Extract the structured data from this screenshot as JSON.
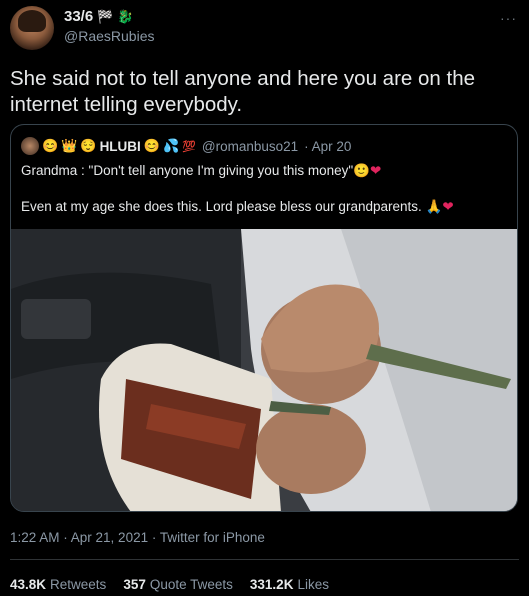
{
  "author": {
    "display_name": "33/6",
    "handle": "@RaesRubies",
    "name_icons": [
      "checkered-flag-icon",
      "dragon-icon"
    ]
  },
  "tweet": {
    "text": "She said not to tell anyone and here you are on the internet telling everybody."
  },
  "quoted": {
    "name_prefix_icons": [
      "smiling-emoji-icon",
      "crown-emoji-icon",
      "relieved-emoji-icon"
    ],
    "name": "HLUBI",
    "name_suffix_icons": [
      "blush-emoji-icon",
      "sweat-droplets-icon",
      "hundred-icon"
    ],
    "handle": "@romanbuso21",
    "date": "· Apr 20",
    "line1": "Grandma : \"Don't tell anyone I'm giving you this money\"",
    "line1_icons": [
      "slight-smile-emoji-icon",
      "red-heart-icon"
    ],
    "line2": "Even at my age she does this. Lord please bless our grandparents.",
    "line2_icons": [
      "praying-hands-icon",
      "red-heart-icon"
    ]
  },
  "meta": {
    "time": "1:22 AM · Apr 21, 2021 · Twitter for iPhone"
  },
  "stats": [
    {
      "value": "43.8K",
      "label": "Retweets"
    },
    {
      "value": "357",
      "label": "Quote Tweets"
    },
    {
      "value": "331.2K",
      "label": "Likes"
    }
  ],
  "more_label": "···"
}
